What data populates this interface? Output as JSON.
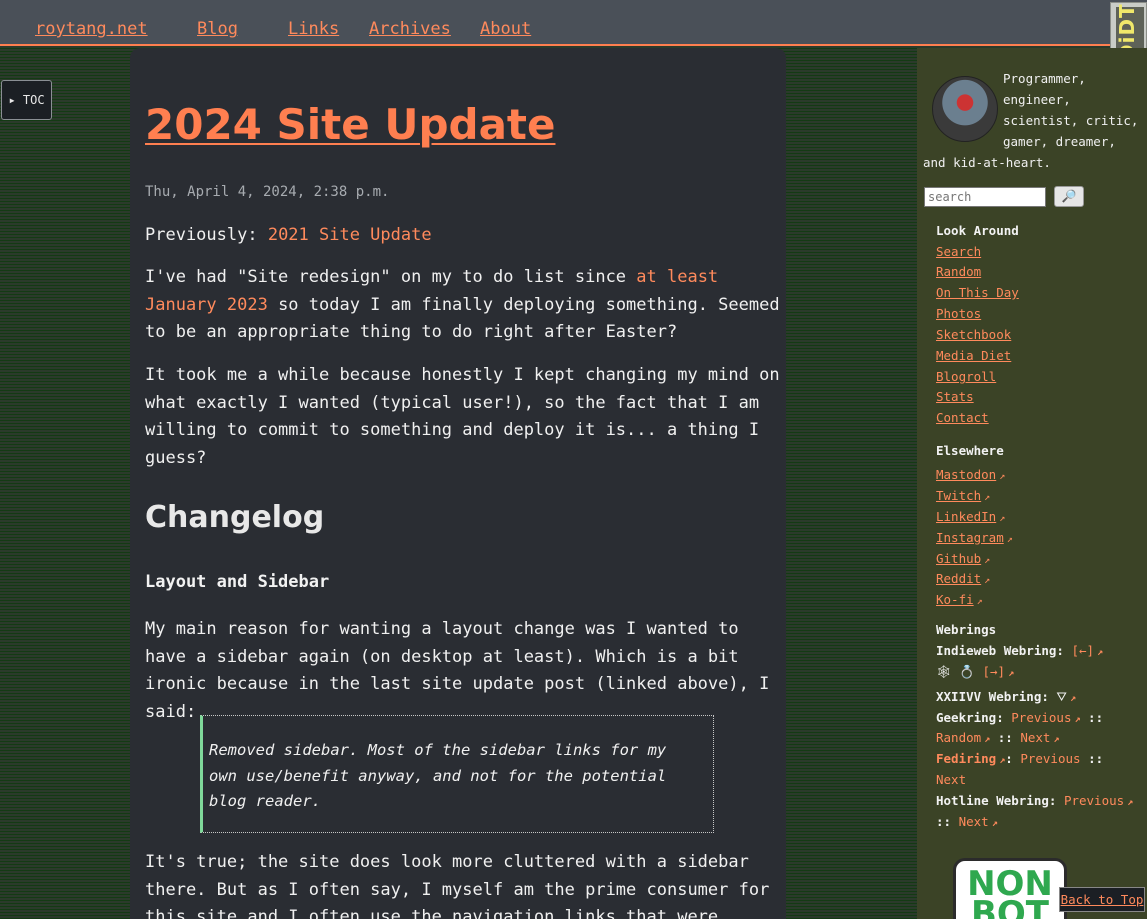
{
  "header": {
    "site_name": "roytang.net",
    "nav": [
      "Blog",
      "Links",
      "Archives",
      "About"
    ],
    "badge_text": "DiDT"
  },
  "toc": {
    "label": "▸ TOC"
  },
  "post": {
    "title": "2024 Site Update",
    "date": "Thu, April 4, 2024, 2:38 p.m.",
    "previously_label": "Previously: ",
    "previously_link": "2021 Site Update",
    "p1_before": "I've had \"Site redesign\" on my to do list since ",
    "p1_link": "at least January 2023",
    "p1_after": " so today I am finally deploying something. Seemed to be an appropriate thing to do right after Easter?",
    "p2": "It took me a while because honestly I kept changing my mind on what exactly I wanted (typical user!), so the fact that I am willing to commit to something and deploy it is... a thing I guess?",
    "h2": "Changelog",
    "h3": "Layout and Sidebar",
    "p3": "My main reason for wanting a layout change was I wanted to have a sidebar again (on desktop at least). Which is a bit ironic because in the last site update post (linked above), I said:",
    "quote": "Removed sidebar. Most of the sidebar links for my own use/benefit anyway, and not for the potential blog reader.",
    "p4": "It's true; the site does look more cluttered with a sidebar there. But as I often say, I myself am the prime consumer for this site and I often use the navigation links that were"
  },
  "sidebar": {
    "bio_1": "Programmer,",
    "bio_2": "engineer,",
    "bio_3": "scientist, critic,",
    "bio_4": "gamer, dreamer,",
    "bio_5": "and kid-at-heart.",
    "search_placeholder": "search",
    "search_button_icon": "🔎",
    "look_around_title": "Look Around",
    "look_around": [
      "Search",
      "Random",
      "On This Day",
      "Photos",
      "Sketchbook",
      "Media Diet",
      "Blogroll",
      "Stats",
      "Contact"
    ],
    "elsewhere_title": "Elsewhere",
    "elsewhere": [
      "Mastodon",
      "Twitch",
      "LinkedIn",
      "Instagram",
      "Github",
      "Reddit",
      "Ko-fi"
    ],
    "ext_icon": "↗",
    "webrings_title": "Webrings",
    "indieweb_label": "Indieweb Webring:",
    "indieweb_prev": "[←]",
    "indieweb_next": "[→]",
    "indieweb_icons": "🕸 💍",
    "xxiivv_label": "XXIIVV Webring:",
    "geekring_label": "Geekring:",
    "geekring_prev": "Previous",
    "geekring_random": "Random",
    "geekring_next": "Next",
    "fediring_label": "Fediring",
    "fediring_prev": "Previous",
    "fediring_next": "Next",
    "hotline_label": "Hotline Webring:",
    "hotline_prev": "Previous",
    "hotline_next": "Next",
    "separator": "::",
    "nonbot_text": "NON BOT"
  },
  "back_to_top": "Back to Top",
  "colors": {
    "accent": "#ff7f50",
    "link": "#ff8a5c",
    "quote_border": "#7fd89a",
    "sidebar_bg": "#3b4326"
  }
}
